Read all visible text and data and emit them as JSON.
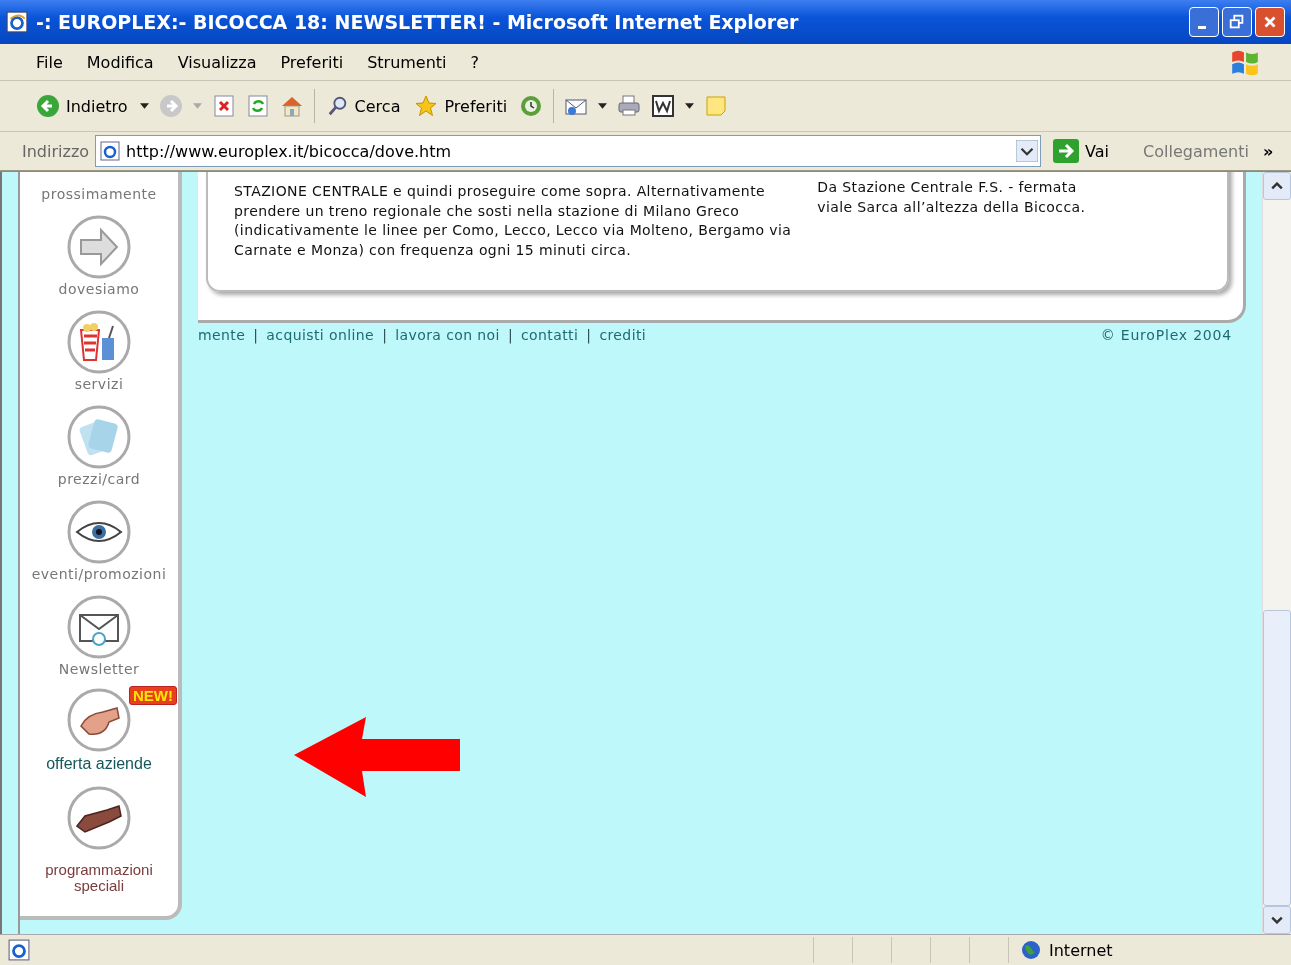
{
  "window": {
    "title": "-: EUROPLEX:- BICOCCA 18: NEWSLETTER! - Microsoft Internet Explorer"
  },
  "menu": [
    "File",
    "Modifica",
    "Visualizza",
    "Preferiti",
    "Strumenti",
    "?"
  ],
  "toolbar": {
    "back": "Indietro",
    "search": "Cerca",
    "favorites": "Preferiti"
  },
  "address": {
    "label": "Indirizzo",
    "value": "http://www.europlex.it/bicocca/dove.htm",
    "go": "Vai",
    "links": "Collegamenti",
    "more": "»"
  },
  "sidebar": [
    {
      "label": "prossimamente",
      "kind": "plain"
    },
    {
      "label": "dovesiamo",
      "kind": "plain"
    },
    {
      "label": "servizi",
      "kind": "plain"
    },
    {
      "label": "prezzi/card",
      "kind": "plain"
    },
    {
      "label": "eventi/promozioni",
      "kind": "plain"
    },
    {
      "label": "Newsletter",
      "kind": "plain"
    },
    {
      "label": "offerta aziende",
      "kind": "featured",
      "badge": "NEW!"
    },
    {
      "label": "programmazioni speciali",
      "kind": "special"
    }
  ],
  "directions": {
    "left": [
      "STAZIONE CENTRALE e quindi proseguire come sopra. Alternativamente",
      "prendere un treno regionale che sosti nella stazione di Milano Greco",
      "(indicativamente le linee per Como, Lecco, Lecco via Molteno, Bergamo via",
      "Carnate e Monza) con frequenza ogni 15 minuti circa."
    ],
    "right": [
      "Da Stazione Centrale F.S. - fermata",
      "viale Sarca all’altezza della Bicocca."
    ]
  },
  "footer": {
    "nav": [
      {
        "kind": "link",
        "text": "mente"
      },
      {
        "kind": "sep",
        "text": "|"
      },
      {
        "kind": "link",
        "text": "acquisti online"
      },
      {
        "kind": "sep",
        "text": "|"
      },
      {
        "kind": "link",
        "text": "lavora con noi"
      },
      {
        "kind": "sep",
        "text": "|"
      },
      {
        "kind": "link",
        "text": "contatti"
      },
      {
        "kind": "sep",
        "text": "|"
      },
      {
        "kind": "link",
        "text": "crediti"
      }
    ],
    "copyright": "© EuroPlex 2004"
  },
  "status_bar": {
    "zone": "Internet"
  }
}
